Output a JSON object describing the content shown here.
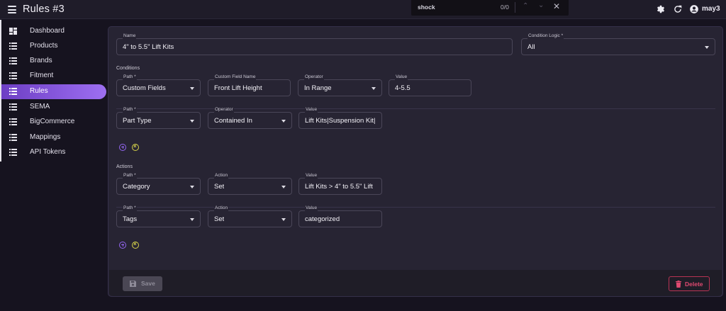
{
  "header": {
    "title": "Rules #3",
    "user": "may3",
    "icons": [
      "menu-icon",
      "gear-icon",
      "refresh-icon",
      "account-icon"
    ]
  },
  "find": {
    "query": "shock",
    "count": "0/0"
  },
  "sidebar": {
    "items": [
      {
        "label": "Dashboard",
        "icon": "dashboard-icon"
      },
      {
        "label": "Products",
        "icon": "list-icon"
      },
      {
        "label": "Brands",
        "icon": "list-icon"
      },
      {
        "label": "Fitment",
        "icon": "list-icon"
      },
      {
        "label": "Rules",
        "icon": "list-icon",
        "active": true
      },
      {
        "label": "SEMA",
        "icon": "list-icon"
      },
      {
        "label": "BigCommerce",
        "icon": "list-icon"
      },
      {
        "label": "Mappings",
        "icon": "list-icon"
      },
      {
        "label": "API Tokens",
        "icon": "list-icon"
      }
    ]
  },
  "form": {
    "name": {
      "label": "Name",
      "value": "4\" to 5.5\" Lift Kits"
    },
    "condition_logic": {
      "label": "Condition Logic *",
      "value": "All"
    },
    "conditions_label": "Conditions",
    "conditions": [
      {
        "path": {
          "label": "Path *",
          "value": "Custom Fields"
        },
        "custom_field": {
          "label": "Custom Field Name",
          "value": "Front Lift Height"
        },
        "operator": {
          "label": "Operator",
          "value": "In Range"
        },
        "value": {
          "label": "Value",
          "value": "4-5.5"
        }
      },
      {
        "path": {
          "label": "Path *",
          "value": "Part Type"
        },
        "operator": {
          "label": "Operator",
          "value": "Contained In"
        },
        "value": {
          "label": "Value",
          "value": "Lift Kits|Suspension Kit|"
        }
      }
    ],
    "actions_label": "Actions",
    "actions": [
      {
        "path": {
          "label": "Path *",
          "value": "Category"
        },
        "action": {
          "label": "Action",
          "value": "Set"
        },
        "value": {
          "label": "Value",
          "value": "Lift Kits > 4\" to 5.5\" Lift"
        }
      },
      {
        "path": {
          "label": "Path *",
          "value": "Tags"
        },
        "action": {
          "label": "Action",
          "value": "Set"
        },
        "value": {
          "label": "Value",
          "value": "categorized"
        }
      }
    ]
  },
  "footer": {
    "save_label": "Save",
    "delete_label": "Delete"
  },
  "colors": {
    "accent": "#8a5be0",
    "delete": "#e04a70",
    "background": "#16131f",
    "card": "#272433"
  }
}
